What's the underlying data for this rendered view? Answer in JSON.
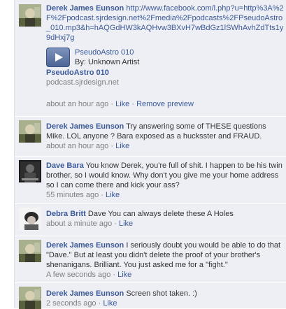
{
  "comments": [
    {
      "author": "Derek James Eunson",
      "link_text": "http://www.facebook.com/l.php?u=http%3A%2F%2Fpodcast.sjrdesign.net%2Fmedia%2Fpodcasts%2FPseudoAstro_010.mp3&h=hAQGdHW3kAQHvw3BXvH7wBdGz1lSWhAvhZdTts1y9dHxj7g",
      "attachment": {
        "track_title": "PseudoAstro 010",
        "artist": "By: Unknown Artist",
        "title": "PseudoAstro 010",
        "domain": "podcast.sjrdesign.net"
      },
      "time": "about an hour ago",
      "like": "Like",
      "remove": "Remove preview"
    },
    {
      "author": "Derek James Eunson",
      "text": "Try answering some of THESE questions Mike. LOL anyone ? Bara exposed as a hucksster and FRAUD.",
      "time": "about an hour ago",
      "like": "Like"
    },
    {
      "author": "Dave Bara",
      "text": "You know Derek, you're full of shit. I happen to be his twin brother, so I would know. Why don't you give me your home address so I can come there and kick your ass?",
      "time": "55 minutes ago",
      "like": "Like"
    },
    {
      "author": "Debra Britt",
      "text": "Dave You can always delete these A Holes",
      "time": "about a minute ago",
      "like": "Like"
    },
    {
      "author": "Derek James Eunson",
      "text": "I seriously doubt you would be able to do that \"Dave.\" But at least you didn't delete the proof of your brother's shenanigans. Brilliant. You just asked me for a \"fight.\"",
      "time": "A few seconds ago",
      "like": "Like"
    },
    {
      "author": "Derek James Eunson",
      "text": "Screen shot taken. :)",
      "time": "2 seconds ago",
      "like": "Like"
    }
  ],
  "separator": " · ",
  "colors": {
    "link": "#3b5998",
    "background": "#edeff4",
    "meta": "#808080"
  }
}
